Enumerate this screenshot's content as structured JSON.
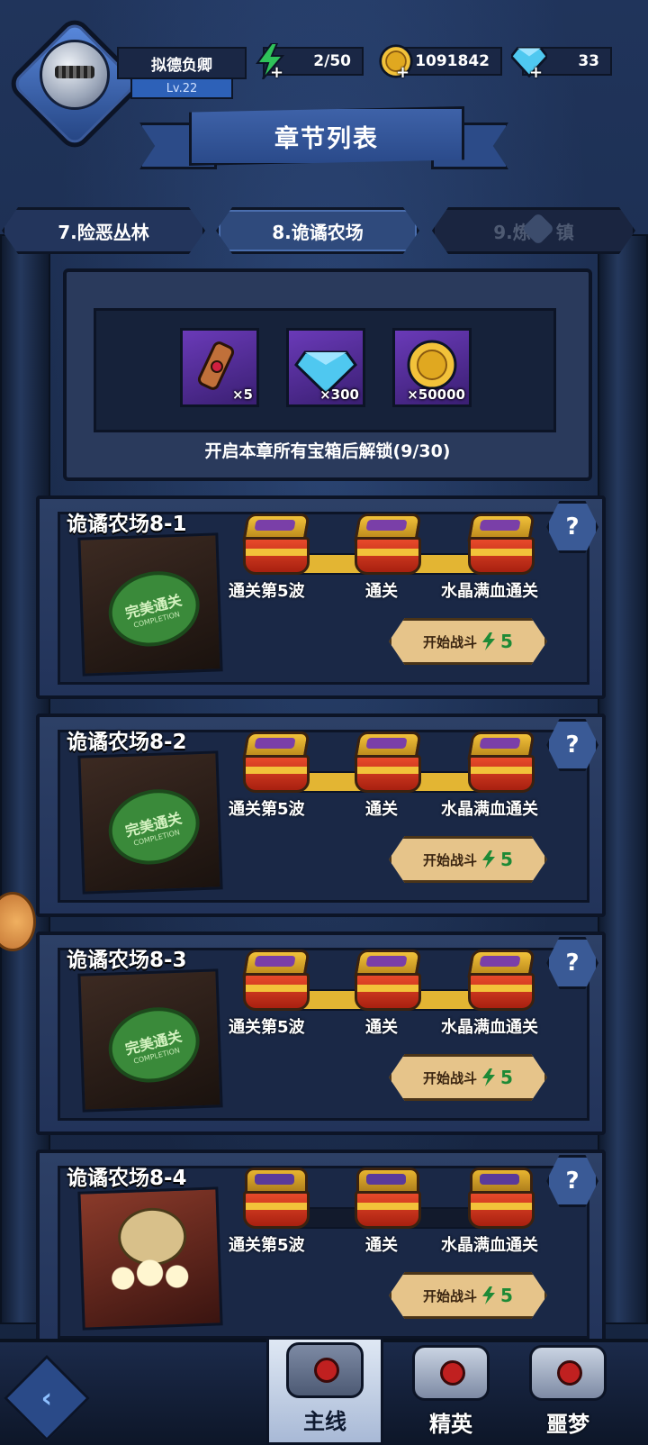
{
  "player": {
    "name": "拟德负卿",
    "level": "Lv.22",
    "avatar_icon": "knight-helmet-icon"
  },
  "resources": {
    "energy": {
      "value": "2/50",
      "icon": "lightning-icon",
      "color": "#2fc25a"
    },
    "coins": {
      "value": "1091842",
      "icon": "gold-coin-icon",
      "color": "#f2c23a"
    },
    "gems": {
      "value": "33",
      "icon": "diamond-icon",
      "color": "#4fc8f0"
    }
  },
  "title": "章节列表",
  "chapters": [
    {
      "label": "7.险恶丛林",
      "state": "normal"
    },
    {
      "label": "8.诡谲农场",
      "state": "active"
    },
    {
      "label": "9.炼",
      "suffix": "镇",
      "state": "locked"
    }
  ],
  "chapter_rewards": {
    "items": [
      {
        "icon": "scroll-icon",
        "qty": "×5"
      },
      {
        "icon": "diamond-icon",
        "qty": "×300"
      },
      {
        "icon": "gold-coin-icon",
        "qty": "×50000"
      }
    ],
    "unlock_text": "开启本章所有宝箱后解锁(9/30)"
  },
  "stages": [
    {
      "title": "诡谲农场8-1",
      "seal": {
        "main": "完美通关",
        "sub": "COMPLETION"
      },
      "conditions": [
        "通关第5波",
        "通关",
        "水晶满血通关"
      ],
      "fight_label": "开始战斗",
      "cost": "5",
      "chests_open": true
    },
    {
      "title": "诡谲农场8-2",
      "seal": {
        "main": "完美通关",
        "sub": "COMPLETION"
      },
      "conditions": [
        "通关第5波",
        "通关",
        "水晶满血通关"
      ],
      "fight_label": "开始战斗",
      "cost": "5",
      "chests_open": true
    },
    {
      "title": "诡谲农场8-3",
      "seal": {
        "main": "完美通关",
        "sub": "COMPLETION"
      },
      "conditions": [
        "通关第5波",
        "通关",
        "水晶满血通关"
      ],
      "fight_label": "开始战斗",
      "cost": "5",
      "chests_open": true
    },
    {
      "title": "诡谲农场8-4",
      "conditions": [
        "通关第5波",
        "通关",
        "水晶满血通关"
      ],
      "fight_label": "开始战斗",
      "cost": "5",
      "chests_open": false
    }
  ],
  "bottom_nav": [
    {
      "label": "主线",
      "active": true
    },
    {
      "label": "精英",
      "active": false
    },
    {
      "label": "噩梦",
      "active": false
    }
  ]
}
